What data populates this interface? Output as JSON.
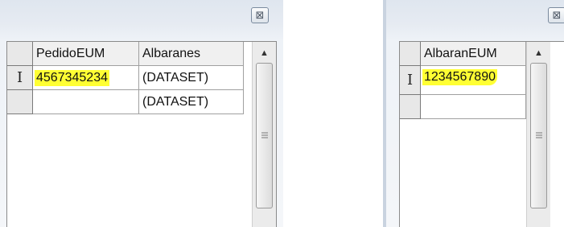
{
  "left_window": {
    "close_label": "⊠",
    "columns": [
      "PedidoEUM",
      "Albaranes"
    ],
    "rows": [
      {
        "indicator": "I",
        "cells": [
          "4567345234",
          "(DATASET)"
        ]
      },
      {
        "indicator": "",
        "cells": [
          "",
          "(DATASET)"
        ]
      }
    ]
  },
  "right_window": {
    "close_label": "⊠",
    "columns": [
      "AlbaranEUM"
    ],
    "rows": [
      {
        "indicator": "I",
        "cells": [
          "1234567890"
        ]
      },
      {
        "indicator": "",
        "cells": [
          ""
        ]
      }
    ]
  },
  "scrollbar": {
    "up_arrow": "▲",
    "grip_icon": "grip-lines-icon"
  },
  "colors": {
    "highlight": "#ffff33",
    "grid_border": "#a0a0a0",
    "frame_bg": "#e6ebf2"
  }
}
